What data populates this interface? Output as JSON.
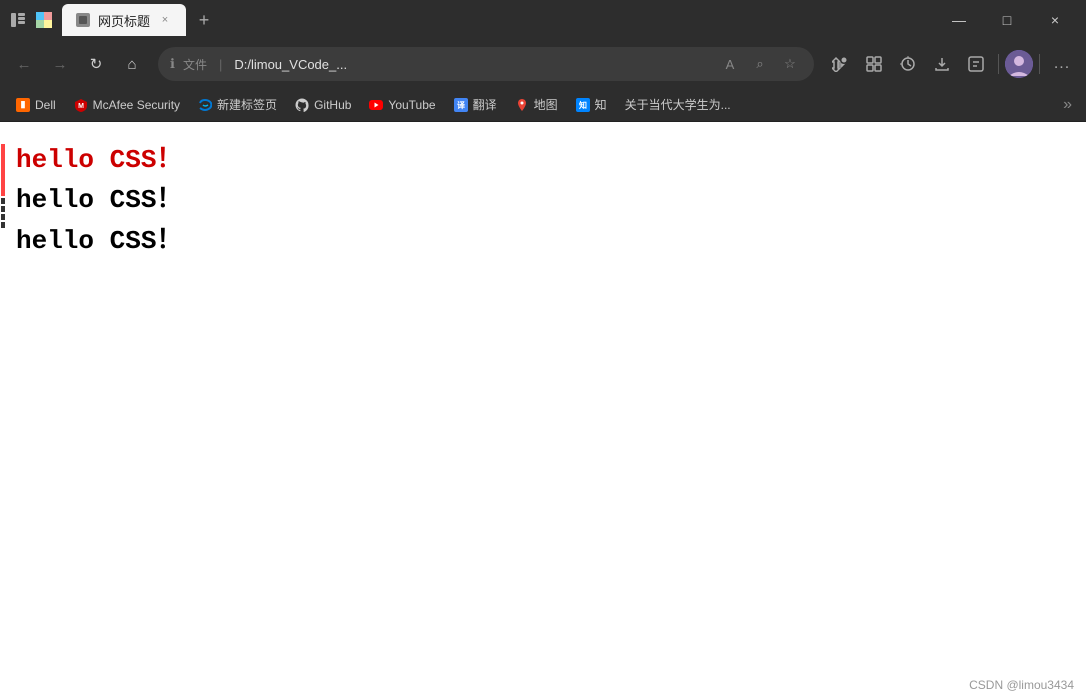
{
  "titleBar": {
    "title": "网页标题",
    "closeLabel": "×",
    "minimizeLabel": "—",
    "maximizeLabel": "□",
    "newTabLabel": "+",
    "browserIcons": {
      "sidebar": "☰",
      "profile": "👤"
    }
  },
  "navBar": {
    "backBtn": "←",
    "forwardBtn": "→",
    "refreshBtn": "↻",
    "homeBtn": "⌂",
    "addressLabel": "文件",
    "addressSeparator": "|",
    "addressUrl": "D:/limou_VCode_...",
    "readModeBtn": "A",
    "searchBtn": "⌕",
    "favBtn": "☆",
    "extensionBtn": "⊕",
    "collectBtn": "⊞",
    "historyBtn": "⊙",
    "downloadBtn": "⬇",
    "accountBtn": "◻",
    "moreBtn": "...",
    "profileBtnLabel": "用户头像"
  },
  "bookmarksBar": {
    "items": [
      {
        "id": "dell",
        "label": "Dell",
        "type": "dell"
      },
      {
        "id": "mcafee",
        "label": "McAfee Security",
        "type": "mcafee"
      },
      {
        "id": "newtab",
        "label": "新建标签页",
        "type": "edge"
      },
      {
        "id": "github",
        "label": "GitHub",
        "type": "github"
      },
      {
        "id": "youtube",
        "label": "YouTube",
        "type": "youtube"
      },
      {
        "id": "translate",
        "label": "翻译",
        "type": "translate"
      },
      {
        "id": "map",
        "label": "地图",
        "type": "map"
      },
      {
        "id": "zhihu",
        "label": "知",
        "type": "zhihu"
      },
      {
        "id": "more",
        "label": "关于当代大学生为...",
        "type": "more"
      }
    ],
    "moreLabel": "»"
  },
  "pageContent": {
    "lines": [
      {
        "id": "line1",
        "text": "hello CSS！",
        "color": "#cc0000"
      },
      {
        "id": "line2",
        "text": "hello CSS！",
        "color": "#000000"
      },
      {
        "id": "line3",
        "text": "hello CSS！",
        "color": "#000000"
      }
    ]
  },
  "watermark": {
    "text": "CSDN @limou3434"
  }
}
